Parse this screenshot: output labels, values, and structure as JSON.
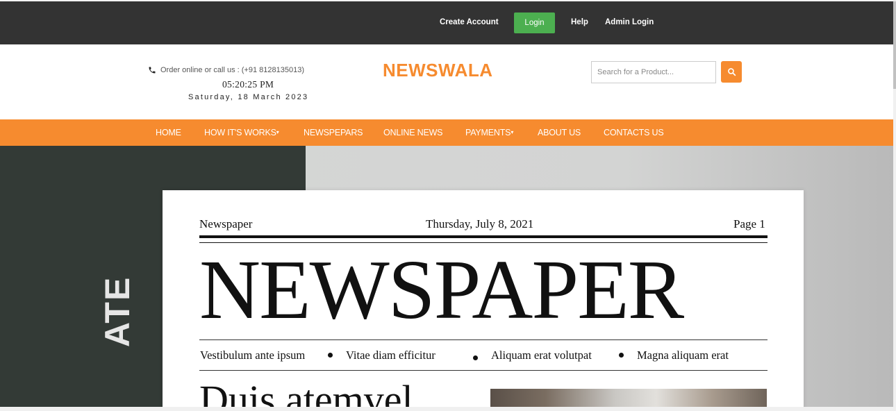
{
  "topbar": {
    "create_account": "Create Account",
    "login": "Login",
    "help": "Help",
    "admin_login": "Admin Login"
  },
  "header": {
    "contact_text": "Order online or call us : (+91 8128135013)",
    "time": "05:20:25 PM",
    "date": "Saturday, 18 March 2023",
    "brand": "NEWSWALA",
    "search_placeholder": "Search for a Product..."
  },
  "nav": {
    "items": [
      {
        "label": "HOME"
      },
      {
        "label": "HOW IT'S WORKS"
      },
      {
        "label": "NEWSPEPARS"
      },
      {
        "label": "ONLINE NEWS"
      },
      {
        "label": "PAYMENTS"
      },
      {
        "label": "ABOUT US"
      },
      {
        "label": "CONTACTS US"
      }
    ]
  },
  "hero": {
    "vertical_text": "ATE",
    "paper": {
      "left_label": "Newspaper",
      "date": "Thursday, July 8, 2021",
      "page": "Page 1",
      "masthead": "NEWSPAPER",
      "subheads": [
        "Vestibulum ante ipsum",
        "Vitae diam efficitur",
        "Aliquam erat volutpat",
        "Magna aliquam erat"
      ],
      "headline": "Duis atemvel"
    }
  },
  "colors": {
    "accent": "#f68b2f",
    "topbar": "#333333",
    "login_button": "#4caf50"
  }
}
